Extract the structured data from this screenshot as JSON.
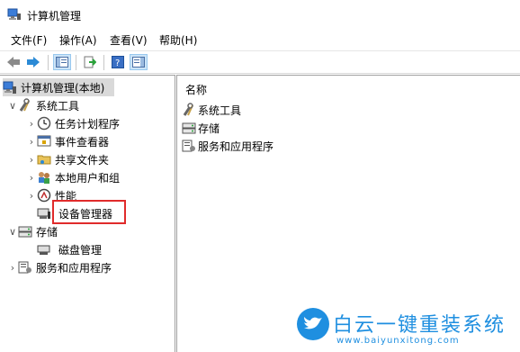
{
  "window": {
    "title": "计算机管理",
    "icon": "computer-management-icon"
  },
  "menu": [
    {
      "label": "文件(F)"
    },
    {
      "label": "操作(A)"
    },
    {
      "label": "查看(V)"
    },
    {
      "label": "帮助(H)"
    }
  ],
  "toolbar": {
    "buttons": [
      "back-arrow-icon",
      "forward-arrow-icon",
      "show-hide-tree-icon",
      "export-list-icon",
      "help-icon",
      "action-pane-icon"
    ]
  },
  "tree": {
    "root": {
      "label": "计算机管理(本地)"
    },
    "system_tools": {
      "label": "系统工具"
    },
    "task_scheduler": {
      "label": "任务计划程序"
    },
    "event_viewer": {
      "label": "事件查看器"
    },
    "shared_folders": {
      "label": "共享文件夹"
    },
    "local_users": {
      "label": "本地用户和组"
    },
    "performance": {
      "label": "性能"
    },
    "device_manager": {
      "label": "设备管理器"
    },
    "storage": {
      "label": "存储"
    },
    "disk_management": {
      "label": "磁盘管理"
    },
    "services_apps": {
      "label": "服务和应用程序"
    }
  },
  "list": {
    "column_name": "名称",
    "items": [
      {
        "label": "系统工具",
        "icon": "tools-icon"
      },
      {
        "label": "存储",
        "icon": "storage-icon"
      },
      {
        "label": "服务和应用程序",
        "icon": "services-icon"
      }
    ]
  },
  "watermark": {
    "title": "白云一键重装系统",
    "url": "www.baiyunxitong.com"
  },
  "colors": {
    "highlight": "#e02b2b",
    "accent": "#1f8fe0",
    "selection": "#d9d9d9"
  }
}
